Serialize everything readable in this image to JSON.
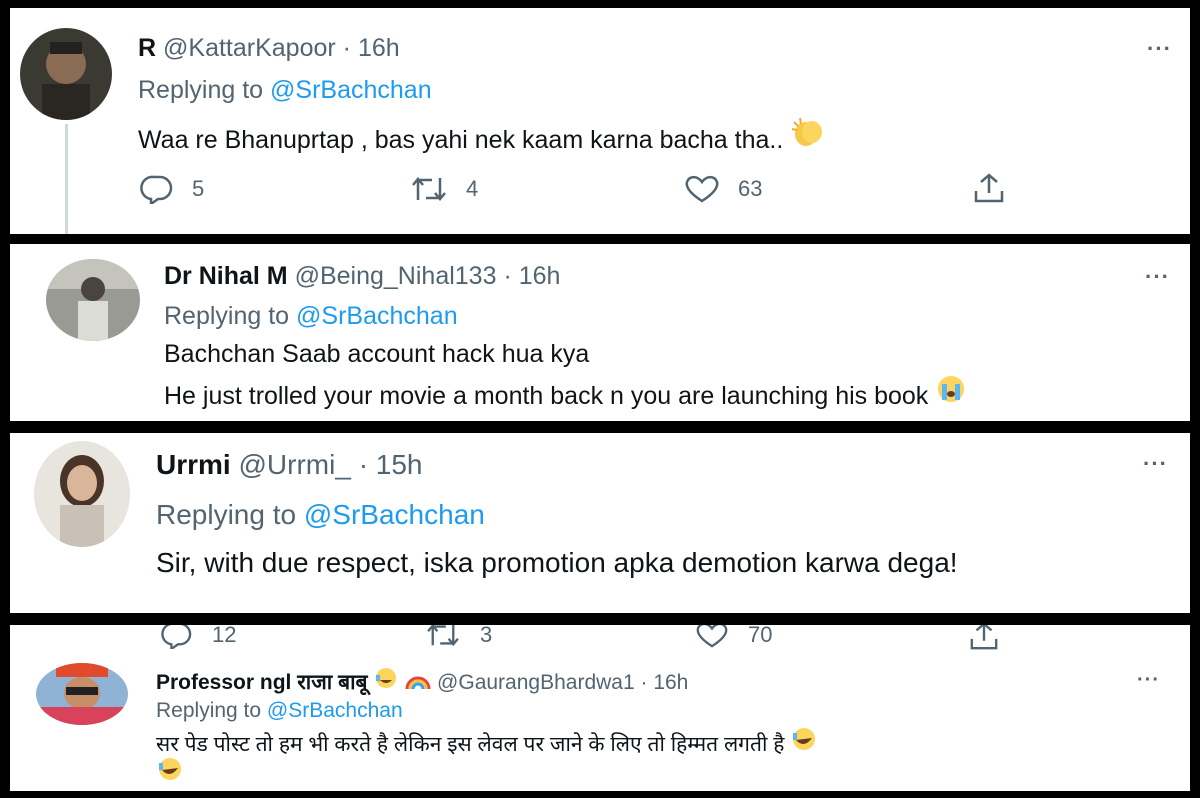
{
  "tweets": [
    {
      "display_name": "R",
      "handle": "@KattarKapoor",
      "time": "· 16h",
      "replying_prefix": "Replying to",
      "replying_to": "@SrBachchan",
      "text": "Waa re Bhanuprtap , bas yahi nek kaam karna bacha tha..",
      "emoji": "clapping-hands",
      "actions": {
        "replies": "5",
        "retweets": "4",
        "likes": "63"
      },
      "more": "···"
    },
    {
      "display_name": "Dr Nihal M",
      "handle": "@Being_Nihal133",
      "time": "· 16h",
      "replying_prefix": "Replying to",
      "replying_to": "@SrBachchan",
      "text_line1": "Bachchan Saab account hack hua kya",
      "text_line2": "He just trolled your movie a month back n you are launching his book",
      "emoji": "crying-face",
      "more": "···"
    },
    {
      "display_name": "Urrmi",
      "handle": "@Urrmi_",
      "time": "· 15h",
      "replying_prefix": "Replying to",
      "replying_to": "@SrBachchan",
      "text": "Sir, with due respect, iska promotion apka demotion karwa dega!",
      "actions": {
        "replies": "12",
        "retweets": "3",
        "likes": "70"
      },
      "more": "···"
    },
    {
      "display_name": "Professor ngl राजा बाबू",
      "handle": "@GaurangBhardwa1",
      "time": "· 16h",
      "replying_prefix": "Replying to",
      "replying_to": "@SrBachchan",
      "text": "सर पेड पोस्ट तो हम भी करते है लेकिन इस लेवल पर जाने के लिए तो हिम्मत लगती है",
      "emoji": "rolling-laughing-face",
      "more": "···"
    }
  ],
  "colors": {
    "text": "#0f1419",
    "secondary": "#536471",
    "link": "#1d9bf0",
    "background": "#000000",
    "card": "#ffffff"
  }
}
